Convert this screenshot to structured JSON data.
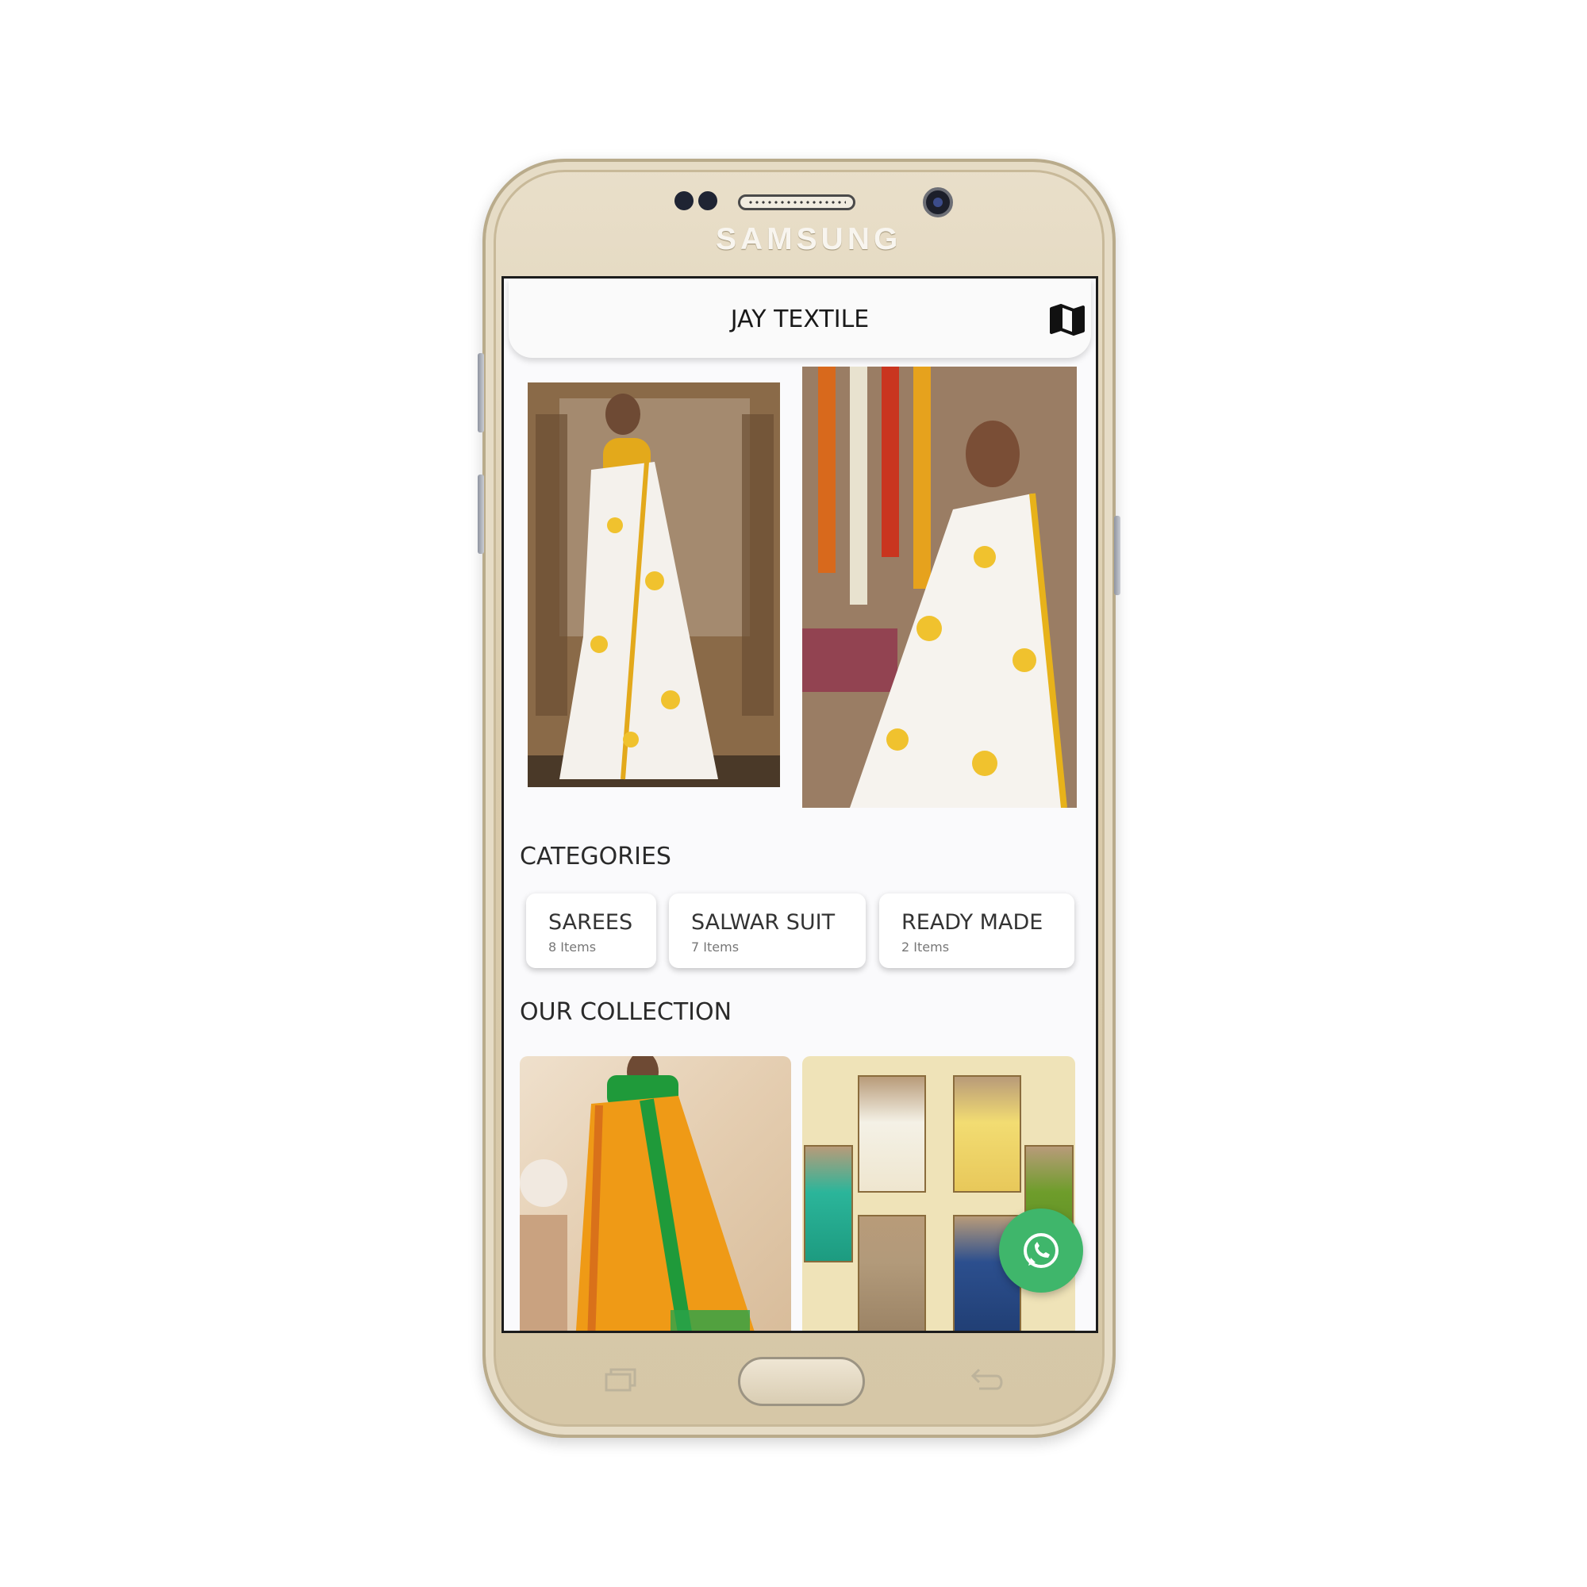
{
  "device": {
    "brand": "SAMSUNG"
  },
  "app": {
    "title": "JAY TEXTILE",
    "header_icon": "map-icon"
  },
  "banners": [
    {
      "name": "white-floral-saree-full"
    },
    {
      "name": "white-floral-saree-closeup"
    }
  ],
  "categories": {
    "heading": "CATEGORIES",
    "items": [
      {
        "label": "SAREES",
        "count": "8 Items"
      },
      {
        "label": "SALWAR SUIT",
        "count": "7 Items"
      },
      {
        "label": "READY MADE",
        "count": "2 Items"
      }
    ]
  },
  "collection": {
    "heading": "OUR COLLECTION",
    "items": [
      {
        "name": "orange-silk-saree"
      },
      {
        "name": "saree-catalog"
      }
    ]
  },
  "fab": {
    "icon": "whatsapp-icon"
  },
  "nav": {
    "recent_icon": "recent-apps-icon",
    "back_icon": "back-icon"
  },
  "colors": {
    "phone_body": "#dacbab",
    "whatsapp": "#3fb66b",
    "screen_bg": "#fafafc"
  }
}
